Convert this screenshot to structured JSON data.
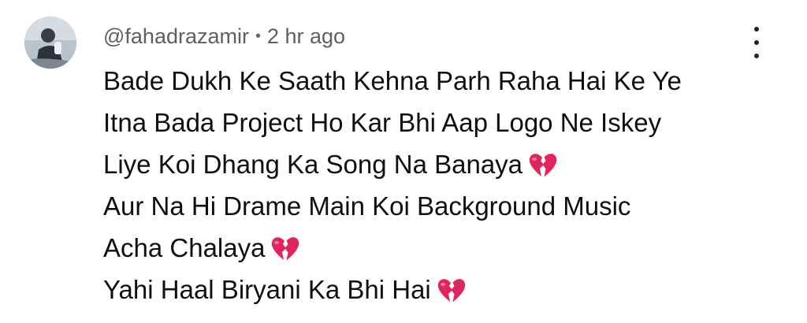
{
  "comment": {
    "author": "@fahadrazamir",
    "separator": "•",
    "time": "2 hr ago",
    "avatar_icon": "user-avatar-photo",
    "menu_icon": "more-vertical-icon",
    "heart_icon": "broken-heart-emoji",
    "heart_color": "#e0245e",
    "lines": [
      {
        "text": "Bade Dukh Ke Saath Kehna Parh Raha Hai Ke Ye",
        "emoji": false
      },
      {
        "text": "Itna Bada Project Ho Kar Bhi Aap Logo Ne Iskey",
        "emoji": false
      },
      {
        "text": "Liye Koi Dhang Ka Song Na Banaya",
        "emoji": true
      },
      {
        "text": "Aur Na Hi Drame Main Koi Background Music",
        "emoji": false
      },
      {
        "text": "Acha Chalaya",
        "emoji": true
      },
      {
        "text": "Yahi Haal Biryani Ka Bhi Hai",
        "emoji": true
      }
    ]
  }
}
